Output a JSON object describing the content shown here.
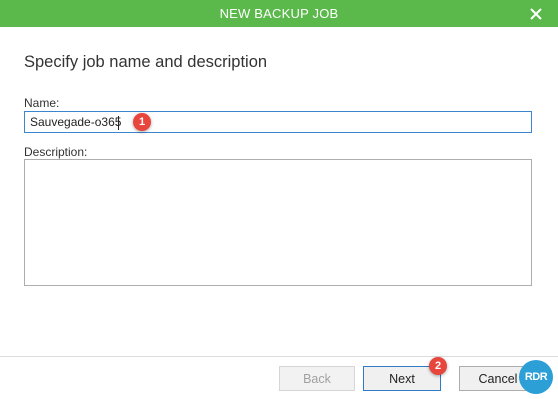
{
  "window": {
    "title": "NEW BACKUP JOB",
    "close_icon": "close-icon"
  },
  "page": {
    "heading": "Specify job name and description"
  },
  "form": {
    "name_label": "Name:",
    "name_value": "Sauvegade-o365",
    "description_label": "Description:",
    "description_value": ""
  },
  "annotations": {
    "step1": "1",
    "step2": "2"
  },
  "buttons": {
    "back": "Back",
    "next": "Next",
    "cancel": "Cancel"
  },
  "watermark": {
    "text": "RDR"
  },
  "colors": {
    "titlebar": "#5ab94a",
    "accent": "#3c86d0",
    "badge": "#e8453c"
  }
}
